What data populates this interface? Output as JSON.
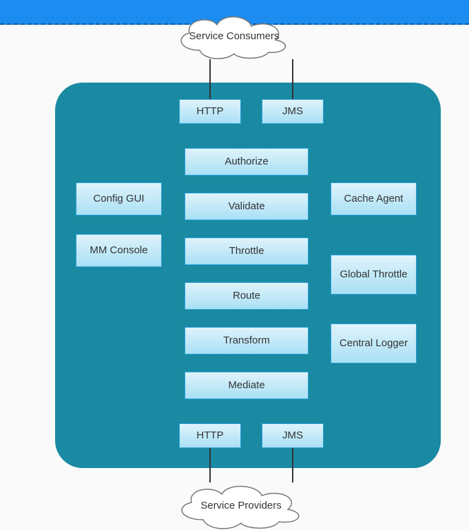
{
  "topbar": {},
  "clouds": {
    "top": "Service Consumers",
    "bottom": "Service Providers"
  },
  "protocols": {
    "http": "HTTP",
    "jms": "JMS"
  },
  "center": {
    "authorize": "Authorize",
    "validate": "Validate",
    "throttle": "Throttle",
    "route": "Route",
    "transform": "Transform",
    "mediate": "Mediate"
  },
  "left": {
    "config_gui": "Config GUI",
    "mm_console": "MM Console"
  },
  "right": {
    "cache_agent": "Cache Agent",
    "global_throttle": "Global Throttle",
    "central_logger": "Central Logger"
  }
}
